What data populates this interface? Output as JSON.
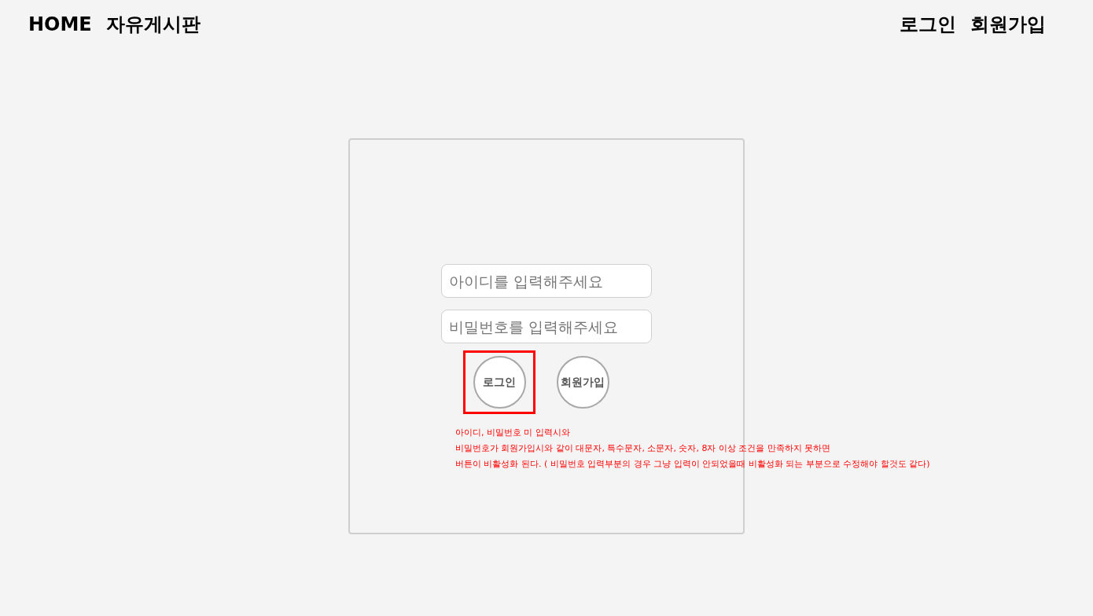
{
  "nav": {
    "left": [
      "HOME",
      "자유게시판"
    ],
    "right": [
      "로그인",
      "회원가입"
    ]
  },
  "login": {
    "fields": [
      {
        "placeholder": "아이디를 입력해주세요"
      },
      {
        "placeholder": "비밀번호를 입력해주세요"
      }
    ],
    "buttons": [
      {
        "label": "로그인",
        "highlighted": true
      },
      {
        "label": "회원가입",
        "highlighted": false
      }
    ],
    "note": [
      "아이디, 비밀번호 미 입력시와",
      "비밀번호가 회원가입시와 같이 대문자, 특수문자, 소문자, 숫자, 8자 이상 조건을 만족하지 못하면",
      "버튼이 비활성화 된다. ( 비밀번호 입력부분의 경우 그냥 입력이 안되었을때 비활성화 되는 부분으로 수정해야 할것도 같다)"
    ]
  }
}
